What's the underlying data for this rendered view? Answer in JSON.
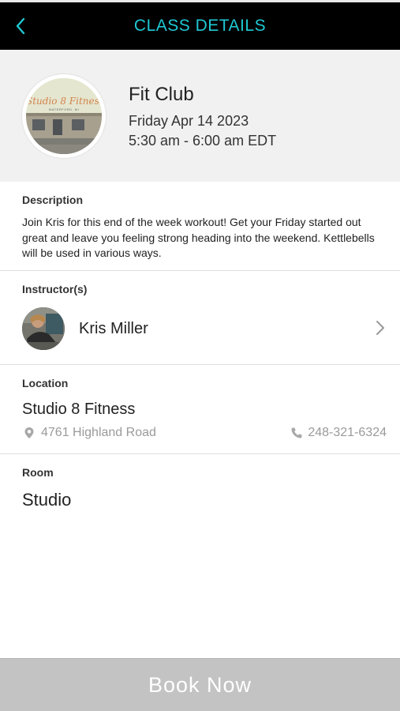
{
  "header": {
    "title": "CLASS DETAILS",
    "back_icon": "chevron-left-icon",
    "accent_color": "#1fc8d3"
  },
  "class": {
    "name": "Fit Club",
    "date": "Friday Apr 14 2023",
    "time": "5:30 am - 6:00 am EDT",
    "logo": {
      "text": "Studio 8 Fitness",
      "subtext": "WATERFORD, MI"
    }
  },
  "description": {
    "label": "Description",
    "text": "Join Kris for this end of the week workout!  Get your Friday started out great and leave you feeling strong heading into the weekend. Kettlebells will be used in various ways."
  },
  "instructors": {
    "label": "Instructor(s)",
    "items": [
      {
        "name": "Kris Miller",
        "icon": "chevron-right-icon"
      }
    ]
  },
  "location": {
    "label": "Location",
    "name": "Studio 8 Fitness",
    "address": "4761 Highland Road",
    "phone": "248-321-6324",
    "address_icon": "map-pin-icon",
    "phone_icon": "phone-icon"
  },
  "room": {
    "label": "Room",
    "name": "Studio"
  },
  "book": {
    "label": "Book Now",
    "color": "#c3c3c3"
  }
}
